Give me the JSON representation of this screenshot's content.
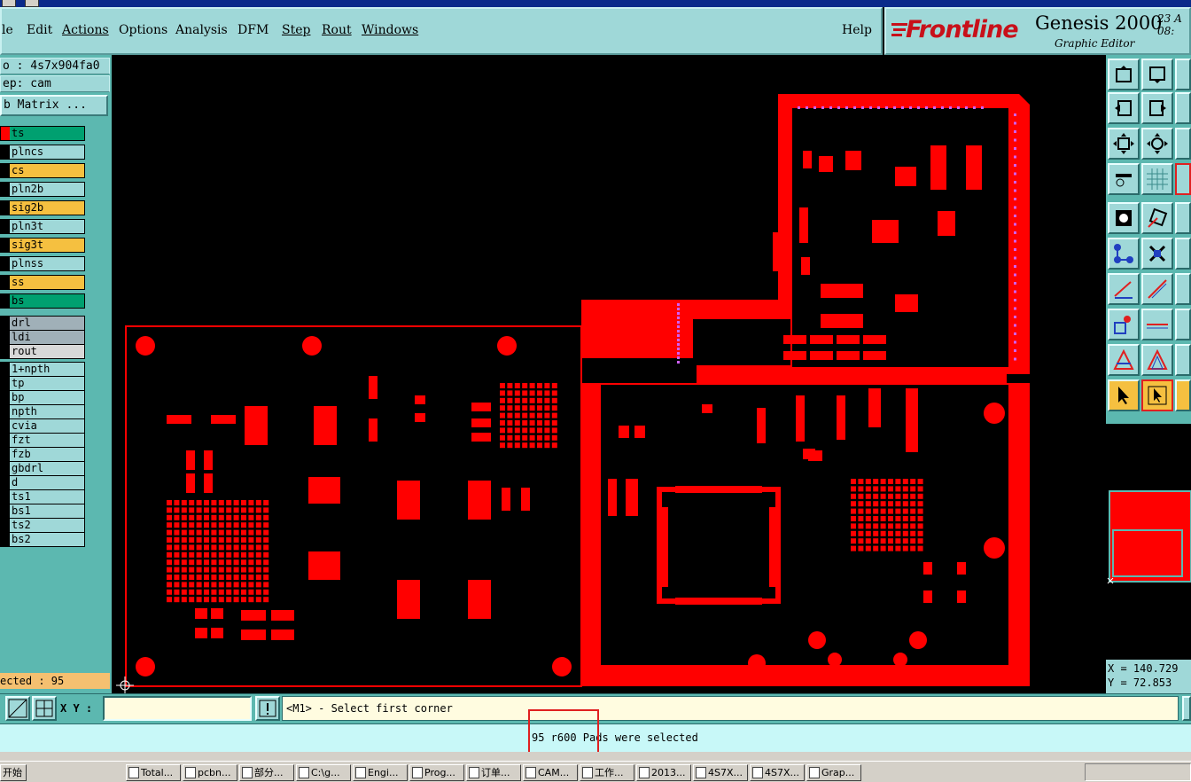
{
  "menubar": {
    "items": [
      "le",
      "Edit",
      "Actions",
      "Options",
      "Analysis",
      "DFM",
      "Step",
      "Rout",
      "Windows"
    ],
    "help": "Help"
  },
  "logo": {
    "brand": "Frontline",
    "product": "Genesis 2000",
    "subtitle": "Graphic Editor",
    "date_line1": "23 A",
    "date_line2": "08:",
    "brand_color": "#c8101a"
  },
  "left_panel": {
    "job": "o : 4s7x904fa0",
    "step": "ep: cam",
    "matrix_button": "b Matrix ...",
    "layers": [
      {
        "name": "ts",
        "color": "#00a070",
        "swatch": "#ff0000"
      },
      {
        "name": "plncs",
        "color": "#9fd8d8",
        "swatch": "#000000"
      },
      {
        "name": "cs",
        "color": "#f5c040",
        "swatch": "#000000"
      },
      {
        "name": "pln2b",
        "color": "#9fd8d8",
        "swatch": "#000000"
      },
      {
        "name": "sig2b",
        "color": "#f5c040",
        "swatch": "#000000"
      },
      {
        "name": "pln3t",
        "color": "#9fd8d8",
        "swatch": "#000000"
      },
      {
        "name": "sig3t",
        "color": "#f5c040",
        "swatch": "#000000"
      },
      {
        "name": "plnss",
        "color": "#9fd8d8",
        "swatch": "#000000"
      },
      {
        "name": "ss",
        "color": "#f5c040",
        "swatch": "#000000"
      },
      {
        "name": "bs",
        "color": "#00a070",
        "swatch": "#000000"
      },
      {
        "name": "drl",
        "color": "#a0b0b8",
        "swatch": "#000000"
      },
      {
        "name": "ldi",
        "color": "#a0b0b8",
        "swatch": "#000000"
      },
      {
        "name": "rout",
        "color": "#d8d8d8",
        "swatch": "#000000"
      },
      {
        "name": "1+npth",
        "color": "#9fd8d8",
        "swatch": "#000000"
      },
      {
        "name": "tp",
        "color": "#9fd8d8",
        "swatch": "#000000"
      },
      {
        "name": "bp",
        "color": "#9fd8d8",
        "swatch": "#000000"
      },
      {
        "name": "npth",
        "color": "#9fd8d8",
        "swatch": "#000000"
      },
      {
        "name": "cvia",
        "color": "#9fd8d8",
        "swatch": "#000000"
      },
      {
        "name": "fzt",
        "color": "#9fd8d8",
        "swatch": "#000000"
      },
      {
        "name": "fzb",
        "color": "#9fd8d8",
        "swatch": "#000000"
      },
      {
        "name": "gbdrl",
        "color": "#9fd8d8",
        "swatch": "#000000"
      },
      {
        "name": "d",
        "color": "#9fd8d8",
        "swatch": "#000000"
      },
      {
        "name": "ts1",
        "color": "#9fd8d8",
        "swatch": "#000000"
      },
      {
        "name": "bs1",
        "color": "#9fd8d8",
        "swatch": "#000000"
      },
      {
        "name": "ts2",
        "color": "#9fd8d8",
        "swatch": "#000000"
      },
      {
        "name": "bs2",
        "color": "#9fd8d8",
        "swatch": "#000000"
      }
    ],
    "selected_count": "ected : 95"
  },
  "right_panel": {
    "coord_x": "X = 140.729",
    "coord_y": "Y = 72.853"
  },
  "command": {
    "xy_label": "X Y :",
    "xy_value": "",
    "prompt": "<M1> - Select first corner"
  },
  "status": {
    "message": "95 r600 Pads were selected"
  },
  "taskbar": {
    "start": "开始",
    "tasks": [
      "Total...",
      "pcbn...",
      "部分...",
      "C:\\g...",
      "Engi...",
      "Prog...",
      "订单...",
      "CAM...",
      "工作...",
      "2013...",
      "4S7X...",
      "4S7X...",
      "Grap..."
    ]
  },
  "colors": {
    "panel": "#9fd8d8",
    "board": "#ff0000",
    "selection": "#d060ff"
  }
}
